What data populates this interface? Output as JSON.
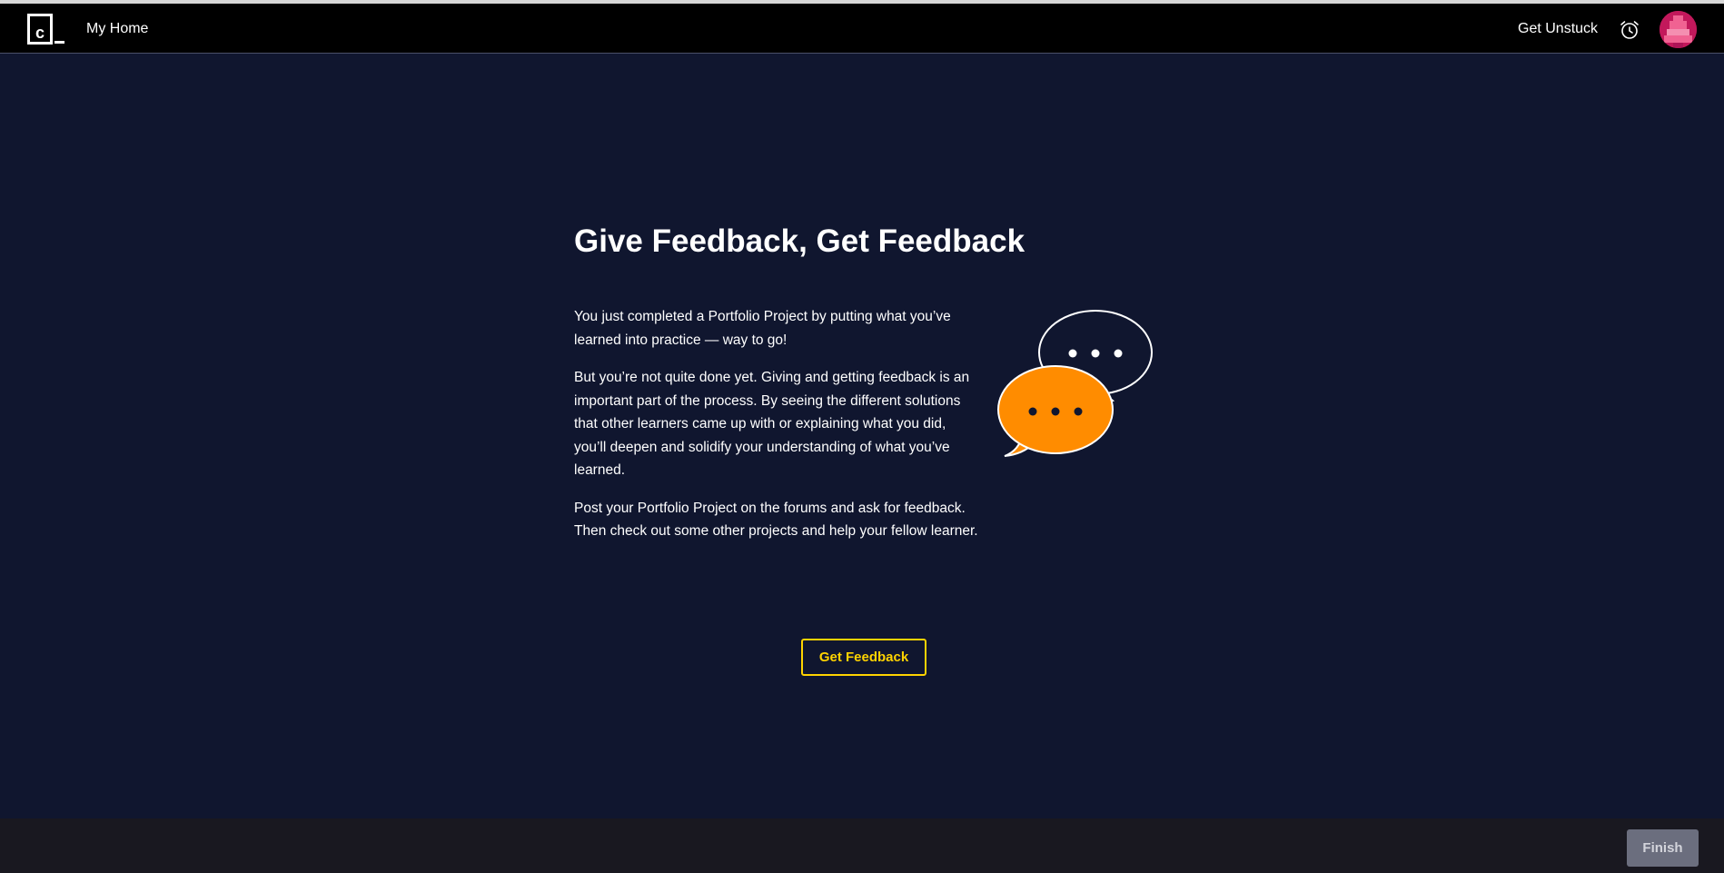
{
  "navbar": {
    "logo_icon": "codecademy-logo-icon",
    "home_label": "My Home",
    "unstuck_label": "Get Unstuck",
    "alarm_icon": "alarm-clock-icon",
    "avatar_icon": "pixel-avatar-icon"
  },
  "main": {
    "title": "Give Feedback, Get Feedback",
    "paragraphs": [
      "You just completed a Portfolio Project by putting what you’ve learned into practice — way to go!",
      "But you’re not quite done yet. Giving and getting feedback is an important part of the process. By seeing the different solutions that other learners came up with or explaining what you did, you’ll deepen and solidify your understanding of what you’ve learned.",
      "Post your Portfolio Project on the forums and ask for feedback. Then check out some other projects and help your fellow learner."
    ],
    "illustration_icon": "chat-bubbles-icon",
    "cta_label": "Get Feedback"
  },
  "footer": {
    "finish_label": "Finish"
  },
  "colors": {
    "background": "#10162f",
    "navbar": "#000000",
    "accent": "#ffd300",
    "bubble_orange": "#ff8c00",
    "footer": "#191820",
    "finish_disabled": "#6b6e7e",
    "avatar": "#c2185b"
  }
}
